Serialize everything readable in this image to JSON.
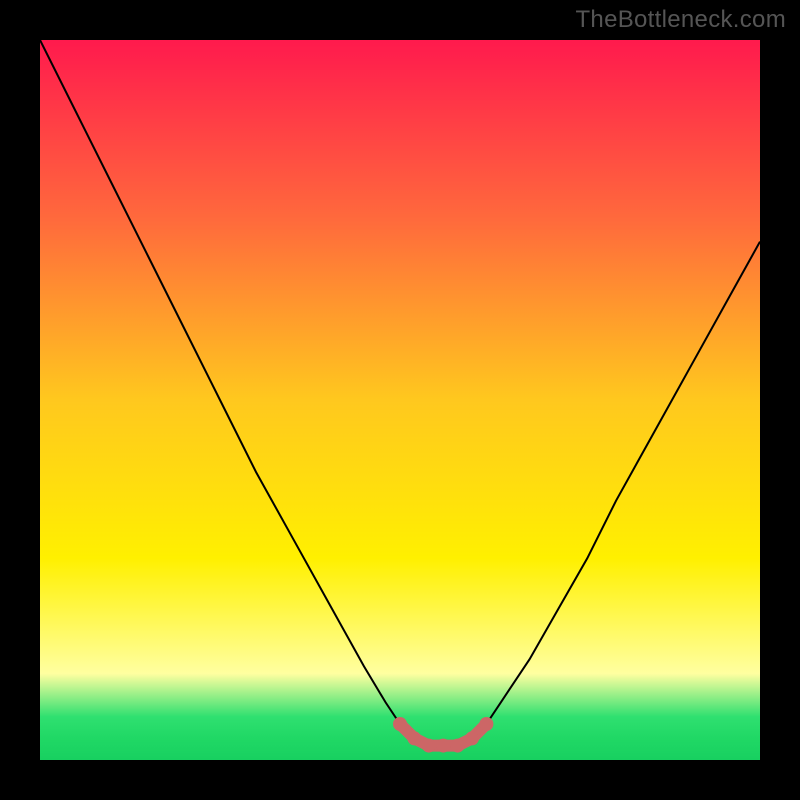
{
  "watermark": "TheBottleneck.com",
  "chart_data": {
    "type": "line",
    "title": "",
    "xlabel": "",
    "ylabel": "",
    "x_range": [
      0,
      100
    ],
    "y_range": [
      0,
      100
    ],
    "series": [
      {
        "name": "bottleneck-curve",
        "stroke": "#000000",
        "stroke_width": 2,
        "x": [
          0,
          5,
          10,
          15,
          20,
          25,
          30,
          35,
          40,
          45,
          48,
          50,
          52,
          54,
          56,
          58,
          60,
          62,
          64,
          68,
          72,
          76,
          80,
          85,
          90,
          95,
          100
        ],
        "y": [
          100,
          90,
          80,
          70,
          60,
          50,
          40,
          31,
          22,
          13,
          8,
          5,
          3,
          2,
          2,
          2,
          3,
          5,
          8,
          14,
          21,
          28,
          36,
          45,
          54,
          63,
          72
        ]
      }
    ],
    "optimal_band": {
      "name": "optimal-zone",
      "color": "#CC6666",
      "x": [
        50,
        52,
        54,
        56,
        58,
        60,
        62
      ],
      "y": [
        5,
        3,
        2,
        2,
        2,
        3,
        5
      ]
    },
    "background": {
      "type": "vertical-gradient-with-green-base",
      "stops": [
        {
          "offset": 0.0,
          "color": "#FF1A4D"
        },
        {
          "offset": 0.25,
          "color": "#FF6A3C"
        },
        {
          "offset": 0.5,
          "color": "#FFC81E"
        },
        {
          "offset": 0.72,
          "color": "#FFF000"
        },
        {
          "offset": 0.88,
          "color": "#FFFFA0"
        },
        {
          "offset": 0.94,
          "color": "#2FE070"
        },
        {
          "offset": 0.97,
          "color": "#20D865"
        },
        {
          "offset": 1.0,
          "color": "#18D060"
        }
      ]
    }
  }
}
